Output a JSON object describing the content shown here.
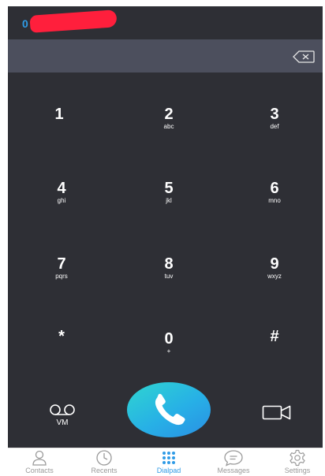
{
  "header": {
    "account_number": "0 5000 1"
  },
  "keypad": {
    "keys": [
      {
        "digit": "1",
        "letters": ""
      },
      {
        "digit": "2",
        "letters": "abc"
      },
      {
        "digit": "3",
        "letters": "def"
      },
      {
        "digit": "4",
        "letters": "ghi"
      },
      {
        "digit": "5",
        "letters": "jkl"
      },
      {
        "digit": "6",
        "letters": "mno"
      },
      {
        "digit": "7",
        "letters": "pqrs"
      },
      {
        "digit": "8",
        "letters": "tuv"
      },
      {
        "digit": "9",
        "letters": "wxyz"
      },
      {
        "digit": "*",
        "letters": ""
      },
      {
        "digit": "0",
        "letters": "+"
      },
      {
        "digit": "#",
        "letters": ""
      }
    ]
  },
  "actions": {
    "voicemail_label": "VM"
  },
  "nav": {
    "items": [
      {
        "label": "Contacts",
        "icon": "contacts-icon"
      },
      {
        "label": "Recents",
        "icon": "clock-icon"
      },
      {
        "label": "Dialpad",
        "icon": "dialpad-icon"
      },
      {
        "label": "Messages",
        "icon": "chat-bubble-icon"
      },
      {
        "label": "Settings",
        "icon": "gear-icon"
      }
    ],
    "active": "Dialpad"
  },
  "colors": {
    "accent": "#2f9be6",
    "keypad_background": "#2e2f35",
    "entry_background": "#4c4f5d",
    "redaction": "#ff1f3c"
  }
}
